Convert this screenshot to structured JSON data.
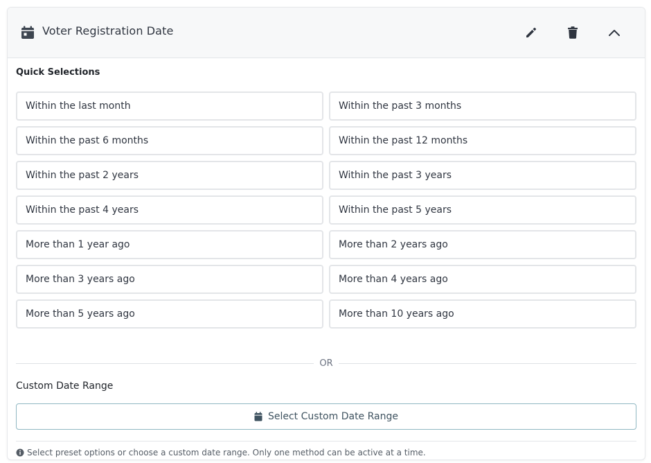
{
  "filter": {
    "title": "Voter Registration Date",
    "icons": {
      "header": "calendar-icon",
      "edit": "pencil-icon",
      "delete": "trash-icon",
      "collapse": "chevron-up-icon"
    }
  },
  "quick": {
    "heading": "Quick Selections",
    "options": [
      "Within the last month",
      "Within the past 3 months",
      "Within the past 6 months",
      "Within the past 12 months",
      "Within the past 2 years",
      "Within the past 3 years",
      "Within the past 4 years",
      "Within the past 5 years",
      "More than 1 year ago",
      "More than 2 years ago",
      "More than 3 years ago",
      "More than 4 years ago",
      "More than 5 years ago",
      "More than 10 years ago"
    ]
  },
  "divider": {
    "label": "OR"
  },
  "custom": {
    "heading": "Custom Date Range",
    "button_label": "Select Custom Date Range"
  },
  "footer": {
    "note": "Select preset options or choose a custom date range. Only one method can be active at a time."
  },
  "colors": {
    "accent_border": "#8fb7c2",
    "header_bg": "#f7f8f9",
    "text": "#2f3540"
  }
}
